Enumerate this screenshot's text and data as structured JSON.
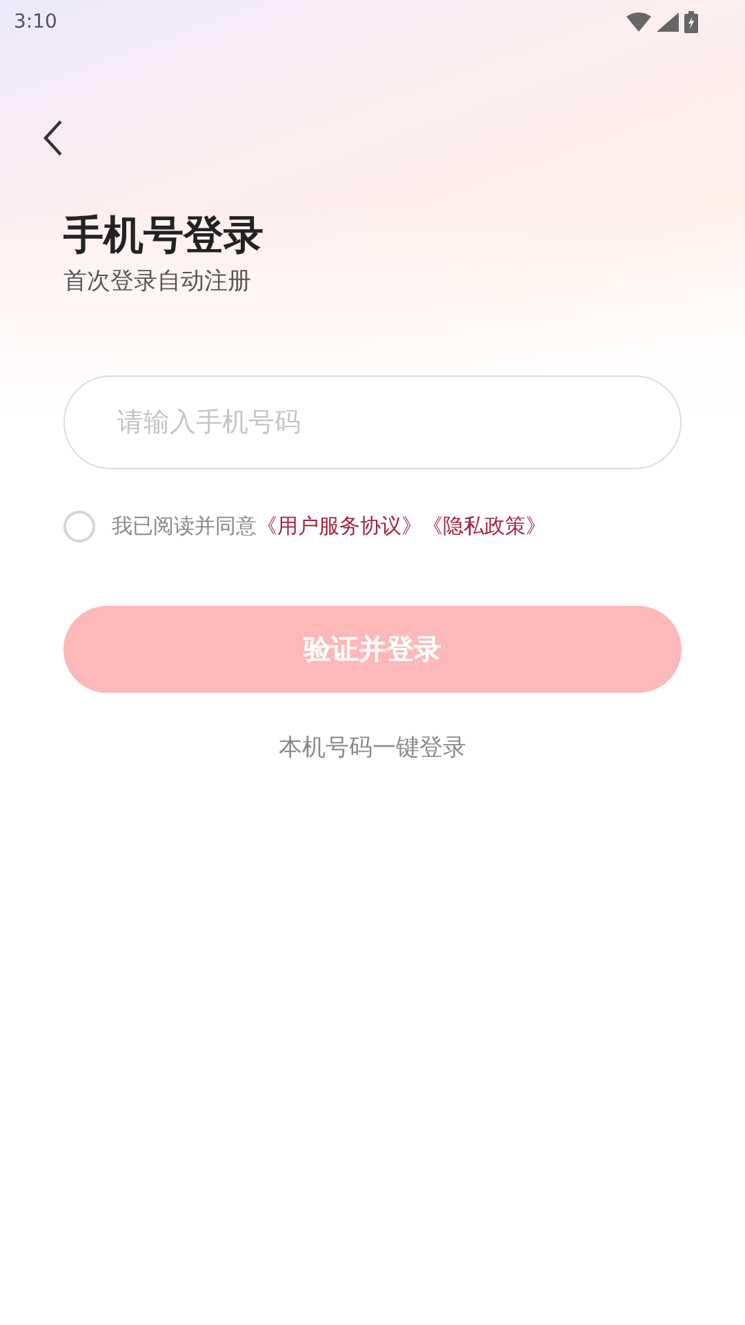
{
  "status_bar": {
    "time": "3:10"
  },
  "title": "手机号登录",
  "subtitle": "首次登录自动注册",
  "phone_field": {
    "placeholder": "请输入手机号码"
  },
  "agreement": {
    "checked": false,
    "text": "我已阅读并同意",
    "links": [
      "《用户服务协议》",
      "《隐私政策》"
    ]
  },
  "login_button": {
    "label": "验证并登录",
    "disabled": true
  },
  "one_click_login": "本机号码一键登录"
}
